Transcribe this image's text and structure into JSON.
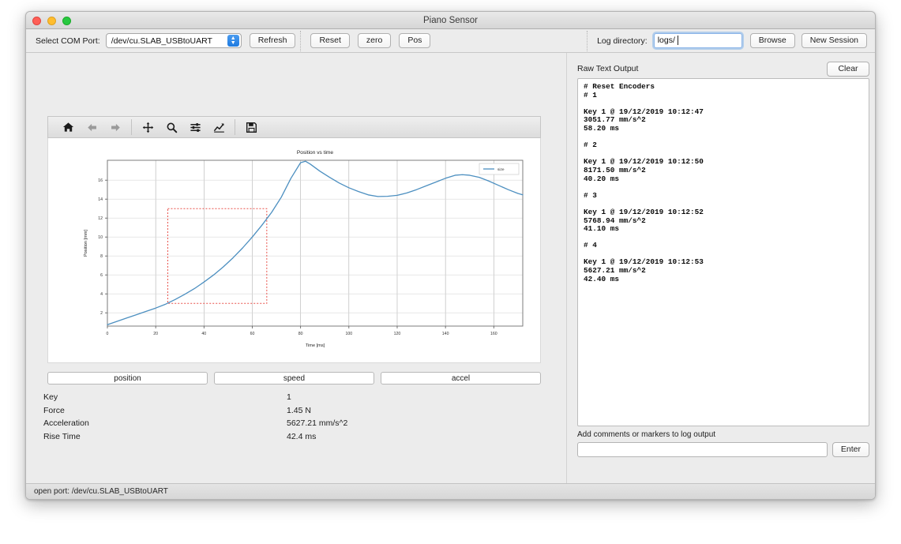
{
  "window": {
    "title": "Piano Sensor"
  },
  "toolbar": {
    "com_label": "Select COM Port:",
    "com_value": "/dev/cu.SLAB_USBtoUART",
    "refresh_label": "Refresh",
    "reset_label": "Reset",
    "zero_label": "zero",
    "pos_label": "Pos",
    "log_label": "Log directory:",
    "log_value": "logs/",
    "browse_label": "Browse",
    "new_session_label": "New Session"
  },
  "plot_toolbar": {
    "home": "home-icon",
    "back": "back-arrow-icon",
    "forward": "forward-arrow-icon",
    "pan": "pan-move-icon",
    "zoom": "zoom-magnifier-icon",
    "configure": "configure-subplots-icon",
    "edit_axis": "edit-axis-curve-icon",
    "save": "save-floppy-icon"
  },
  "modes": {
    "position": "position",
    "speed": "speed",
    "accel": "accel"
  },
  "readout": {
    "rows": [
      {
        "key": "Key",
        "value": "1"
      },
      {
        "key": "Force",
        "value": "1.45 N"
      },
      {
        "key": "Acceleration",
        "value": "5627.21 mm/s^2"
      },
      {
        "key": "Rise Time",
        "value": "42.4 ms"
      }
    ]
  },
  "raw_output": {
    "title": "Raw Text Output",
    "clear_label": "Clear",
    "text": "# Reset Encoders\n# 1\n\nKey 1 @ 19/12/2019 10:12:47\n3051.77 mm/s^2\n58.20 ms\n\n# 2\n\nKey 1 @ 19/12/2019 10:12:50\n8171.50 mm/s^2\n40.20 ms\n\n# 3\n\nKey 1 @ 19/12/2019 10:12:52\n5768.94 mm/s^2\n41.10 ms\n\n# 4\n\nKey 1 @ 19/12/2019 10:12:53\n5627.21 mm/s^2\n42.40 ms\n"
  },
  "comments": {
    "label": "Add comments or markers to log output",
    "value": "",
    "placeholder": "",
    "enter_label": "Enter"
  },
  "status": {
    "text": "open port: /dev/cu.SLAB_USBtoUART"
  },
  "colors": {
    "line": "#4c8fc0",
    "selection": "#e8514a",
    "accent": "#2d7fe0"
  },
  "chart_data": {
    "type": "line",
    "title": "Position vs time",
    "xlabel": "Time [ms]",
    "ylabel": "Position [mm]",
    "xlim": [
      0,
      172
    ],
    "ylim": [
      0.6,
      18.1
    ],
    "xticks": [
      0,
      20,
      40,
      60,
      80,
      100,
      120,
      140,
      160
    ],
    "yticks": [
      2,
      4,
      6,
      8,
      10,
      12,
      14,
      16
    ],
    "grid": true,
    "legend": {
      "position": "upper right",
      "entries": [
        "size"
      ]
    },
    "selection_box": {
      "x0": 25,
      "x1": 66,
      "y0": 3.0,
      "y1": 13.0,
      "color": "#e8514a",
      "style": "dashed"
    },
    "series": [
      {
        "name": "size",
        "color": "#4c8fc0",
        "x": [
          0,
          4,
          8,
          12,
          16,
          20,
          24,
          28,
          32,
          36,
          40,
          44,
          48,
          52,
          56,
          60,
          64,
          68,
          72,
          76,
          80,
          82,
          84,
          88,
          92,
          96,
          100,
          104,
          108,
          112,
          116,
          120,
          124,
          128,
          132,
          136,
          140,
          144,
          147,
          150,
          154,
          158,
          162,
          166,
          170,
          172
        ],
        "y": [
          0.75,
          1.1,
          1.45,
          1.8,
          2.15,
          2.5,
          2.9,
          3.4,
          3.95,
          4.55,
          5.25,
          6.0,
          6.85,
          7.8,
          8.85,
          10.0,
          11.25,
          12.6,
          14.2,
          16.2,
          17.85,
          18.0,
          17.7,
          16.95,
          16.3,
          15.7,
          15.2,
          14.8,
          14.45,
          14.28,
          14.3,
          14.4,
          14.65,
          15.0,
          15.4,
          15.8,
          16.2,
          16.52,
          16.58,
          16.52,
          16.3,
          15.9,
          15.45,
          15.0,
          14.6,
          14.45
        ]
      }
    ]
  }
}
